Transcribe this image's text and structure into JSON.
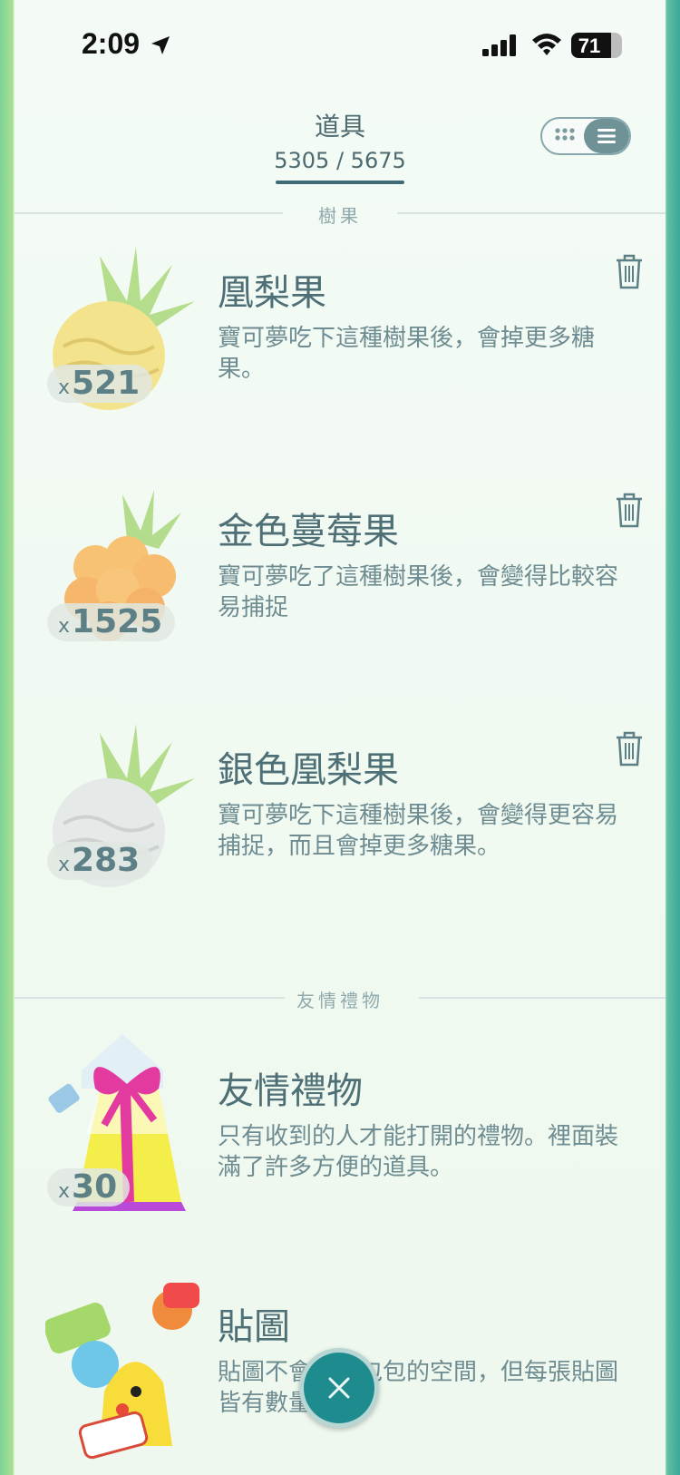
{
  "status_bar": {
    "time": "2:09",
    "battery": "71"
  },
  "header": {
    "title": "道具",
    "count": "5305 / 5675"
  },
  "sections": {
    "berries": "樹果",
    "gifts": "友情禮物"
  },
  "items": [
    {
      "name": "凰梨果",
      "desc": "寶可夢吃下這種樹果後，會掉更多糖果。",
      "qty_prefix": "x",
      "qty": "521",
      "icon": "golden-pinap-berry-icon"
    },
    {
      "name": "金色蔓莓果",
      "desc": "寶可夢吃了這種樹果後，會變得比較容易捕捉",
      "qty_prefix": "x",
      "qty": "1525",
      "icon": "golden-razz-berry-icon"
    },
    {
      "name": "銀色凰梨果",
      "desc": "寶可夢吃下這種樹果後，會變得更容易捕捉，而且會掉更多糖果。",
      "qty_prefix": "x",
      "qty": "283",
      "icon": "silver-pinap-berry-icon"
    },
    {
      "name": "友情禮物",
      "desc": "只有收到的人才能打開的禮物。裡面裝滿了許多方便的道具。",
      "qty_prefix": "x",
      "qty": "30",
      "icon": "gift-icon"
    },
    {
      "name": "貼圖",
      "desc": "貼圖不會佔用包包的空間，但每張貼圖皆有數量限制。",
      "icon": "stickers-icon"
    }
  ],
  "colors": {
    "accent": "#1e8c8e",
    "text": "#4e6f76"
  }
}
